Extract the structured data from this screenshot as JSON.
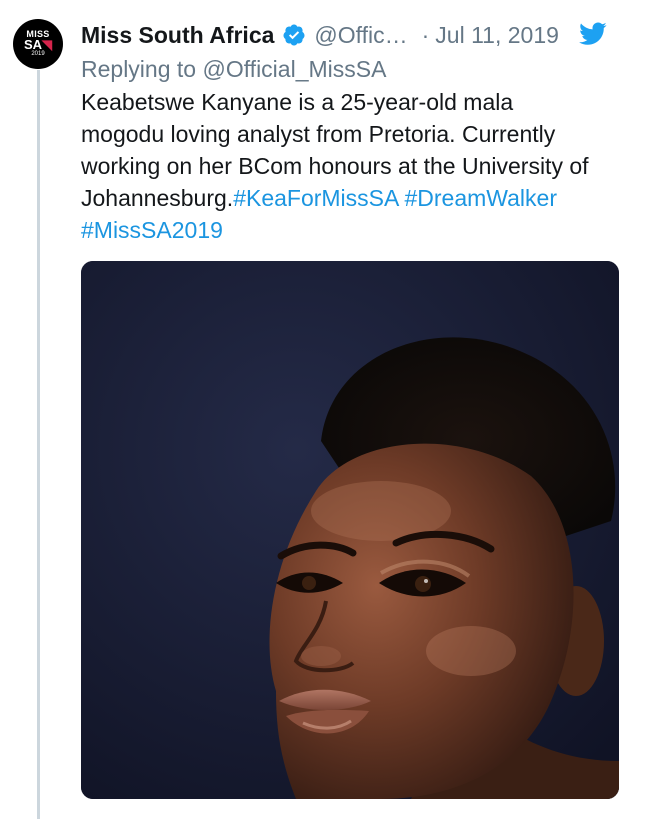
{
  "tweet": {
    "display_name": "Miss South Africa",
    "handle": "@Offic…",
    "separator": "·",
    "date": "Jul 11, 2019",
    "replying_prefix": "Replying to",
    "replying_to": "@Official_MissSA",
    "avatar": {
      "line1": "MISS",
      "line2_a": "SA",
      "line2_b": "",
      "line3": "2019"
    },
    "body": {
      "line1": "Keabetswe Kanyane is a 25-year-old mala",
      "line2": "mogodu loving analyst from Pretoria. Currently",
      "line3": "working on her BCom honours at the University of",
      "line4_text": "Johannesburg.",
      "hashtag1": "#KeaForMissSA",
      "hashtag2": "#DreamWalker",
      "hashtag3": "#MissSA2019"
    },
    "icons": {
      "verified": "verified-badge-icon",
      "platform": "twitter-bird-icon"
    },
    "colors": {
      "link": "#1b95e0",
      "muted": "#657786",
      "verified": "#1da1f2"
    }
  }
}
